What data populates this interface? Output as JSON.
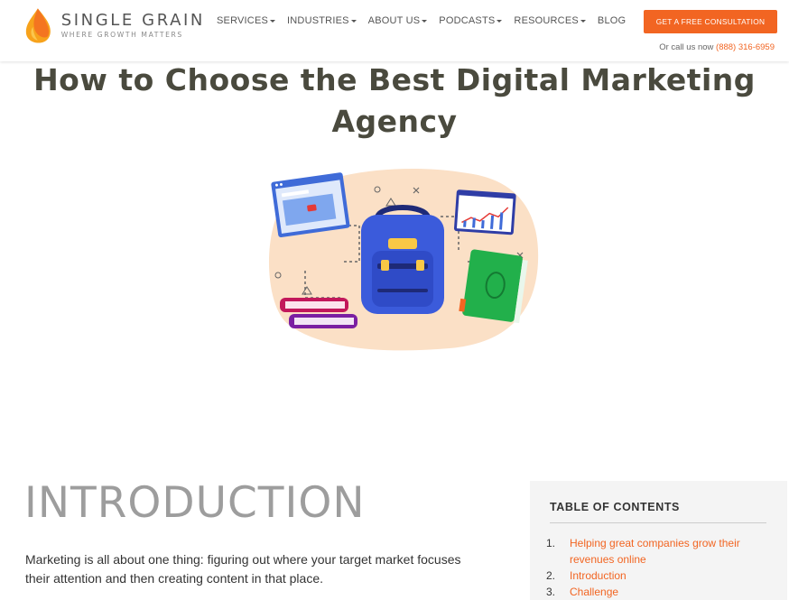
{
  "brand": {
    "name": "SINGLE GRAIN",
    "tagline": "WHERE GROWTH MATTERS",
    "accent": "#f26522"
  },
  "nav": {
    "items": [
      {
        "label": "SERVICES",
        "has_dropdown": true
      },
      {
        "label": "INDUSTRIES",
        "has_dropdown": true
      },
      {
        "label": "ABOUT US",
        "has_dropdown": true
      },
      {
        "label": "PODCASTS",
        "has_dropdown": true
      },
      {
        "label": "RESOURCES",
        "has_dropdown": true
      },
      {
        "label": "BLOG",
        "has_dropdown": false
      }
    ],
    "cta_label": "GET A FREE CONSULTATION",
    "call_prefix": "Or call us now",
    "phone": "(888) 316-6959"
  },
  "article": {
    "title_line1": "How to Choose the Best Digital Marketing",
    "title_line2": "Agency",
    "section_heading": "INTRODUCTION",
    "intro_paragraph": "Marketing is all about one thing: figuring out where your target market focuses their attention and then creating content in that place."
  },
  "toc": {
    "title": "TABLE OF CONTENTS",
    "items": [
      {
        "num": "1.",
        "label": "Helping great companies grow their revenues online"
      },
      {
        "num": "2.",
        "label": "Introduction"
      },
      {
        "num": "3.",
        "label": "Challenge"
      }
    ]
  }
}
